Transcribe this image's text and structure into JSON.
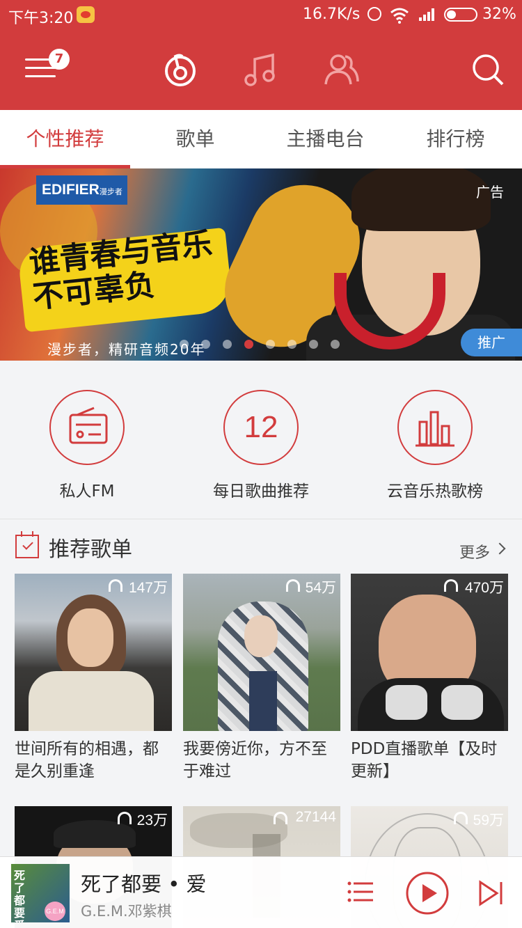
{
  "status_bar": {
    "time": "下午3:20",
    "speed": "16.7K/s",
    "battery": "32%"
  },
  "header": {
    "menu_badge": "7",
    "icons": [
      "menu-icon",
      "netease-music-icon",
      "music-note-icon",
      "friends-icon",
      "search-icon"
    ]
  },
  "tabs": [
    {
      "label": "个性推荐",
      "active": true
    },
    {
      "label": "歌单",
      "active": false
    },
    {
      "label": "主播电台",
      "active": false
    },
    {
      "label": "排行榜",
      "active": false
    }
  ],
  "banner": {
    "brand": "EDIFIER",
    "brand_sub": "漫步者",
    "slogan": "谁青春与音乐不可辜负",
    "caption": "漫步者，精研音频20年",
    "ad_label": "广告",
    "promo_label": "推广",
    "dot_count": 8,
    "active_dot": 2
  },
  "features": [
    {
      "label": "私人FM",
      "icon": "radio-icon"
    },
    {
      "label": "每日歌曲推荐",
      "icon": "calendar-day-icon",
      "number": "12"
    },
    {
      "label": "云音乐热歌榜",
      "icon": "chart-bars-icon"
    }
  ],
  "section": {
    "title": "推荐歌单",
    "more": "更多"
  },
  "playlists": [
    {
      "plays": "147万",
      "title": "世间所有的相遇，都是久别重逢"
    },
    {
      "plays": "54万",
      "title": "我要傍近你，方不至于难过"
    },
    {
      "plays": "470万",
      "title": "PDD直播歌单【及时更新】"
    },
    {
      "plays": "23万",
      "title": ""
    },
    {
      "plays": "27144",
      "title": ""
    },
    {
      "plays": "59万",
      "title": ""
    }
  ],
  "player": {
    "song": "死了都要 • 爱",
    "artist": "G.E.M.邓紫棋",
    "cover_text": "G.E.M"
  },
  "colors": {
    "accent": "#d23c3d",
    "promo": "#3f8bd8"
  }
}
